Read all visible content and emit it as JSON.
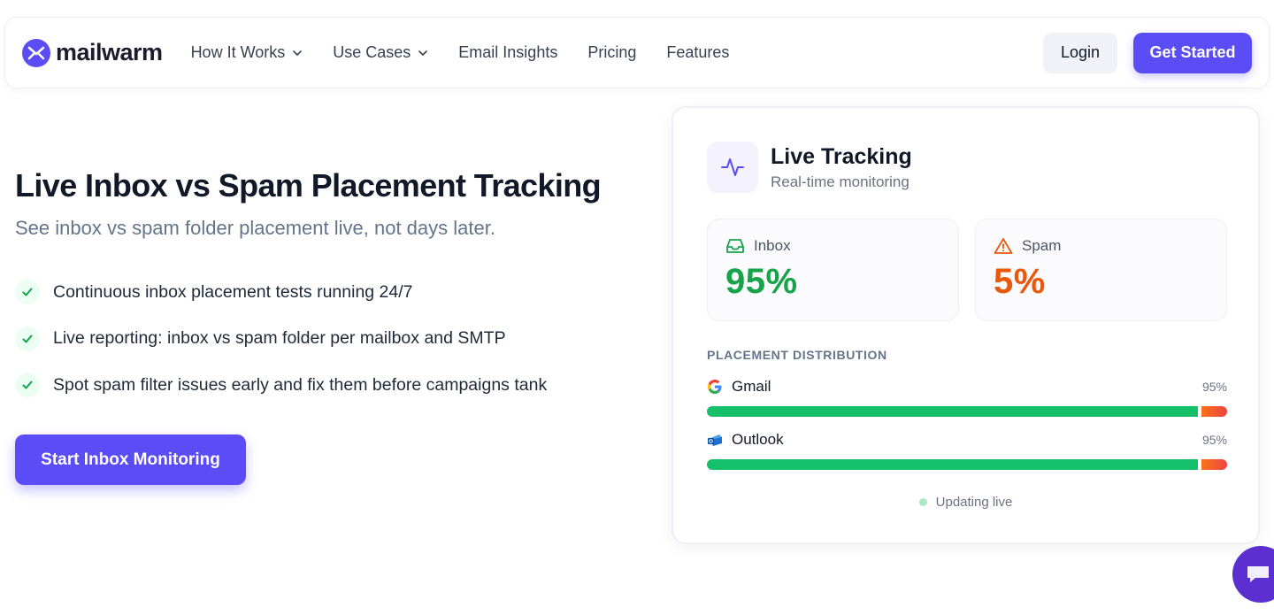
{
  "brand": {
    "name": "mailwarm",
    "accent": "#5b4cf5"
  },
  "nav": {
    "items": [
      {
        "label": "How It Works",
        "dropdown": true
      },
      {
        "label": "Use Cases",
        "dropdown": true
      },
      {
        "label": "Email Insights",
        "dropdown": false
      },
      {
        "label": "Pricing",
        "dropdown": false
      },
      {
        "label": "Features",
        "dropdown": false
      }
    ],
    "login_label": "Login",
    "get_started_label": "Get Started"
  },
  "hero": {
    "title": "Live Inbox vs Spam Placement Tracking",
    "subtitle": "See inbox vs spam folder placement live, not days later.",
    "features": [
      "Continuous inbox placement tests running 24/7",
      "Live reporting: inbox vs spam folder per mailbox and SMTP",
      "Spot spam filter issues early and fix them before campaigns tank"
    ],
    "cta_label": "Start Inbox Monitoring"
  },
  "card": {
    "title": "Live Tracking",
    "subtitle": "Real-time monitoring",
    "inbox": {
      "label": "Inbox",
      "value": "95%",
      "color": "#16a34a"
    },
    "spam": {
      "label": "Spam",
      "value": "5%",
      "color": "#ea580c"
    },
    "distribution_title": "PLACEMENT DISTRIBUTION",
    "providers": [
      {
        "name": "Gmail",
        "percent": "95%",
        "inbox_fraction": 0.95,
        "icon": "google-icon"
      },
      {
        "name": "Outlook",
        "percent": "95%",
        "inbox_fraction": 0.95,
        "icon": "outlook-icon"
      }
    ],
    "status": "Updating live"
  },
  "chat": {
    "icon": "chat-bubble-icon"
  }
}
